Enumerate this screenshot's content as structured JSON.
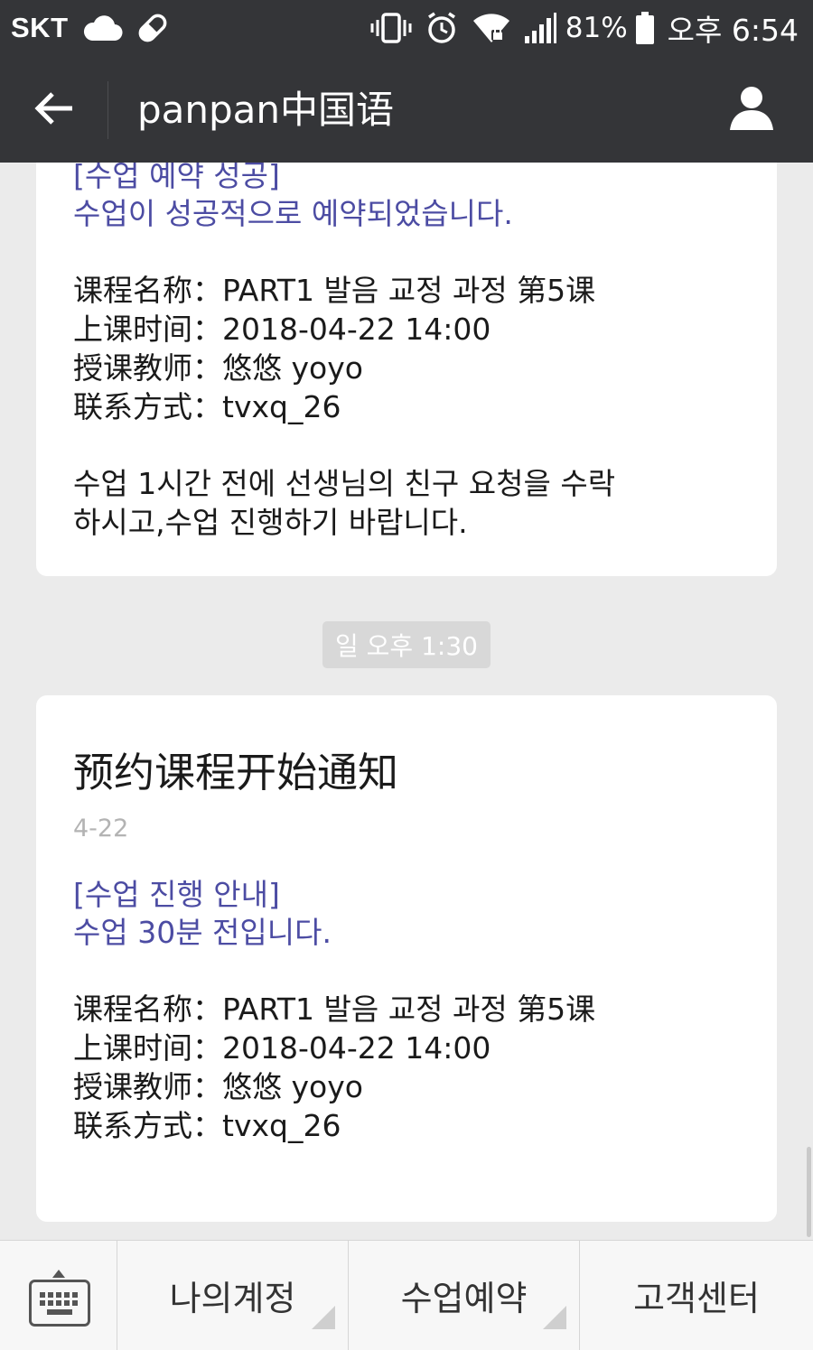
{
  "status_bar": {
    "carrier": "SKT",
    "battery_percent": "81%",
    "time": "오후 6:54",
    "icons": [
      "cloud-icon",
      "pill-icon",
      "vibrate-icon",
      "alarm-icon",
      "wifi-lock-icon",
      "signal-icon",
      "battery-icon"
    ]
  },
  "header": {
    "title": "panpan中国语",
    "back_icon": "arrow-left-icon",
    "profile_icon": "person-icon"
  },
  "messages": [
    {
      "notice_lines": [
        "[수업 예약 성공]",
        "수업이 성공적으로 예약되었습니다."
      ],
      "details": [
        "课程名称：PART1 발음 교정 과정 第5课",
        "上课时间：2018-04-22 14:00",
        "授课教师：悠悠 yoyo",
        "联系方式：tvxq_26"
      ],
      "note_lines": [
        "수업 1시간 전에 선생님의 친구 요청을 수락",
        "하시고,수업 진행하기 바랍니다."
      ]
    },
    {
      "title": "预约课程开始通知",
      "date": "4-22",
      "notice_lines": [
        "[수업 진행 안내]",
        "수업 30분 전입니다."
      ],
      "details": [
        "课程名称：PART1 발음 교정 과정 第5课",
        "上课时间：2018-04-22 14:00",
        "授课教师：悠悠 yoyo",
        "联系方式：tvxq_26"
      ]
    }
  ],
  "timestamp": "일 오후 1:30",
  "bottom_menu": {
    "keyboard_icon": "keyboard-icon",
    "items": [
      {
        "label": "나의계정"
      },
      {
        "label": "수업예약"
      },
      {
        "label": "고객센터"
      }
    ]
  },
  "colors": {
    "header_bg": "#343538",
    "background": "#ebebeb",
    "notice_text": "#4c4ca3",
    "card_bg": "#ffffff",
    "date_text": "#b3b3b3",
    "timestamp_chip": "#d8d8d8"
  }
}
